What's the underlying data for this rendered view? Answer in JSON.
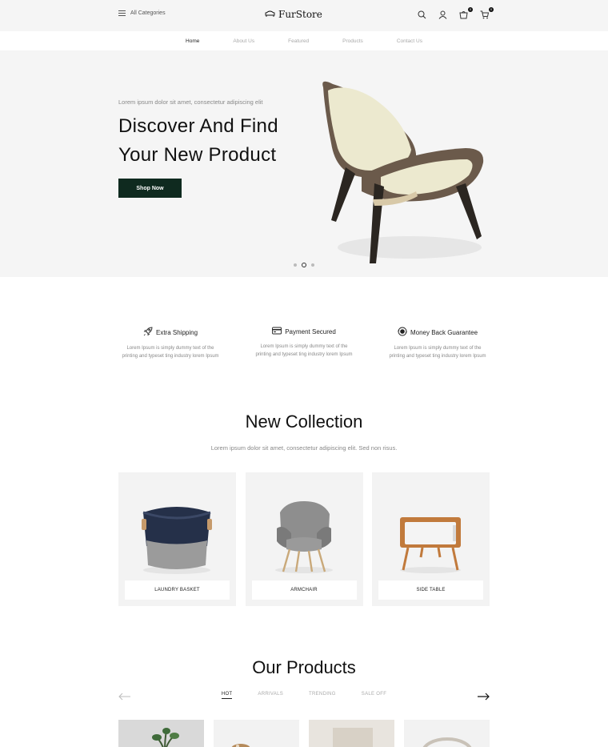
{
  "header": {
    "categories_label": "All Categories",
    "brand": "FurStore",
    "cart_badge": "0",
    "bag_badge": "0"
  },
  "nav": {
    "items": [
      "Home",
      "About Us",
      "Featured",
      "Products",
      "Contact Us"
    ],
    "active": "Home"
  },
  "hero": {
    "subtitle": "Lorem ipsum dolor sit amet, consectetur adipiscing elit",
    "title_line1": "Discover And Find",
    "title_line2": "Your New Product",
    "button": "Shop Now",
    "slides": 3,
    "active_slide": 2
  },
  "features": [
    {
      "title": "Extra Shipping",
      "icon": "rocket-icon",
      "desc_line1": "Lorem Ipsum is simply dummy text of the",
      "desc_line2": "printing and typeset ting industry lorem Ipsum"
    },
    {
      "title": "Payment Secured",
      "icon": "card-icon",
      "desc_line1": "Lorem Ipsum is simply dummy text of the",
      "desc_line2": "printing and typeset ting industry lorem Ipsum"
    },
    {
      "title": "Money Back Guarantee",
      "icon": "money-back-icon",
      "desc_line1": "Lorem Ipsum is simply dummy text of the",
      "desc_line2": "printing and typeset ting industry lorem Ipsum"
    }
  ],
  "collection": {
    "title": "New Collection",
    "subtitle": "Lorem ipsum dolor sit amet, consectetur adipiscing elit. Sed non risus.",
    "items": [
      "LAUNDRY BASKET",
      "ARMCHAIR",
      "SIDE TABLE"
    ]
  },
  "products": {
    "title": "Our Products",
    "tabs": [
      "HOT",
      "ARRIVALS",
      "TRENDING",
      "SALE OFF"
    ],
    "active_tab": "HOT"
  },
  "colors": {
    "accent": "#0f2a1f",
    "hero_bg": "#f5f5f5"
  }
}
